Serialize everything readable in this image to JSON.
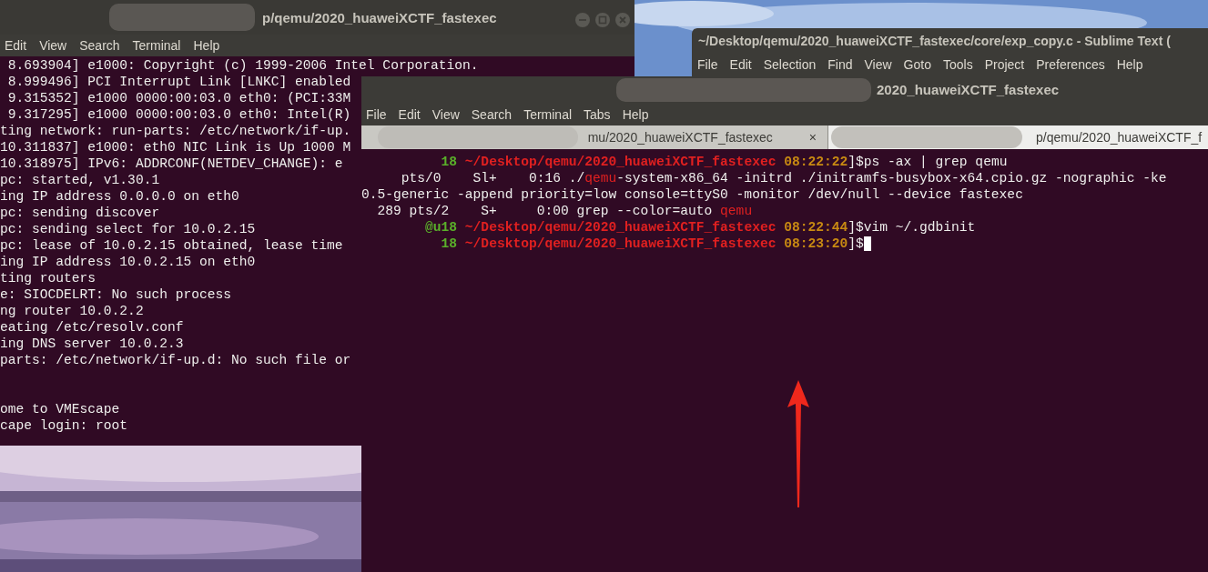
{
  "back_terminal": {
    "title": "p/qemu/2020_huaweiXCTF_fastexec",
    "menu": [
      "Edit",
      "View",
      "Search",
      "Terminal",
      "Help"
    ],
    "log_lines": [
      " 8.693904] e1000: Copyright (c) 1999-2006 Intel Corporation.",
      " 8.999496] PCI Interrupt Link [LNKC] enabled",
      " 9.315352] e1000 0000:00:03.0 eth0: (PCI:33M",
      " 9.317295] e1000 0000:00:03.0 eth0: Intel(R)",
      "ting network: run-parts: /etc/network/if-up.",
      "10.311837] e1000: eth0 NIC Link is Up 1000 M",
      "10.318975] IPv6: ADDRCONF(NETDEV_CHANGE): e",
      "pc: started, v1.30.1",
      "ing IP address 0.0.0.0 on eth0",
      "pc: sending discover",
      "pc: sending select for 10.0.2.15",
      "pc: lease of 10.0.2.15 obtained, lease time",
      "ing IP address 10.0.2.15 on eth0",
      "ting routers",
      "e: SIOCDELRT: No such process",
      "ng router 10.0.2.2",
      "eating /etc/resolv.conf",
      "ing DNS server 10.0.2.3",
      "parts: /etc/network/if-up.d: No such file or"
    ],
    "login_lines": [
      "ome to VMEscape",
      "cape login: root"
    ]
  },
  "editor_window": {
    "title": "~/Desktop/qemu/2020_huaweiXCTF_fastexec/core/exp_copy.c - Sublime Text (",
    "menu": [
      "File",
      "Edit",
      "Selection",
      "Find",
      "View",
      "Goto",
      "Tools",
      "Project",
      "Preferences",
      "Help"
    ]
  },
  "front_terminal": {
    "title": "2020_huaweiXCTF_fastexec",
    "menu": [
      "File",
      "Edit",
      "View",
      "Search",
      "Terminal",
      "Tabs",
      "Help"
    ],
    "cursor": true,
    "tabs": [
      {
        "label": "mu/2020_huaweiXCTF_fastexec",
        "selected": false,
        "close": "×"
      },
      {
        "label": "p/qemu/2020_huaweiXCTF_f",
        "selected": true
      }
    ],
    "lines": [
      {
        "segments": [
          {
            "kind": "host",
            "text": "          18 "
          },
          {
            "kind": "path",
            "text": "~/Desktop/qemu/2020_huaweiXCTF_fastexec"
          },
          {
            "kind": "time",
            "text": " 08:22:22"
          },
          {
            "kind": "plain",
            "text": "]$ps -ax | grep qemu"
          }
        ]
      },
      {
        "segments": [
          {
            "kind": "plain",
            "text": "     pts/0    Sl+    0:16 ./"
          },
          {
            "kind": "match",
            "text": "qemu"
          },
          {
            "kind": "plain",
            "text": "-system-x86_64 -initrd ./initramfs-busybox-x64.cpio.gz -nographic -ke"
          }
        ]
      },
      {
        "segments": [
          {
            "kind": "plain",
            "text": "0.5-generic -append priority=low console=ttyS0 -monitor /dev/null --device fastexec"
          }
        ]
      },
      {
        "segments": [
          {
            "kind": "plain",
            "text": "  289 pts/2    S+     0:00 grep --color=auto "
          },
          {
            "kind": "match",
            "text": "qemu"
          }
        ]
      },
      {
        "segments": [
          {
            "kind": "host",
            "text": "        @u18 "
          },
          {
            "kind": "path",
            "text": "~/Desktop/qemu/2020_huaweiXCTF_fastexec"
          },
          {
            "kind": "time",
            "text": " 08:22:44"
          },
          {
            "kind": "plain",
            "text": "]$vim ~/.gdbinit"
          }
        ]
      },
      {
        "segments": [
          {
            "kind": "host",
            "text": "          18 "
          },
          {
            "kind": "path",
            "text": "~/Desktop/qemu/2020_huaweiXCTF_fastexec"
          },
          {
            "kind": "time",
            "text": " 08:23:20"
          },
          {
            "kind": "plain",
            "text": "]$"
          }
        ]
      }
    ]
  }
}
